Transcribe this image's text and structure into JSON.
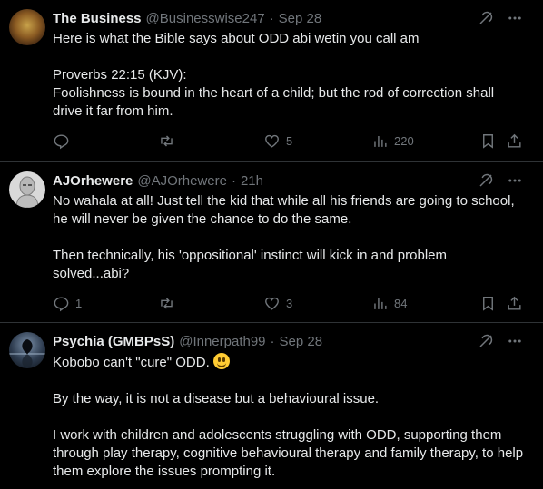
{
  "tweets": [
    {
      "name": "The Business",
      "handle": "@Businesswise247",
      "sep": "·",
      "date": "Sep 28",
      "paragraphs": [
        "Here is what the Bible says about ODD abi wetin you call am",
        "Proverbs 22:15 (KJV):\nFoolishness is bound in the heart of a child; but the rod of correction shall drive it far from him."
      ],
      "replies": "",
      "reposts": "",
      "likes": "5",
      "views": "220"
    },
    {
      "name": "AJOrhewere",
      "handle": "@AJOrhewere",
      "sep": "·",
      "date": "21h",
      "paragraphs": [
        "No wahala at all! Just tell the kid that while all his friends are going to school, he will never be given the chance to do the same.",
        "Then technically, his 'oppositional' instinct will kick in and problem solved...abi?"
      ],
      "replies": "1",
      "reposts": "",
      "likes": "3",
      "views": "84"
    },
    {
      "name": "Psychia (GMBPsS)",
      "handle": "@Innerpath99",
      "sep": "·",
      "date": "Sep 28",
      "paragraphs": [
        "Kobobo can't \"cure\" ODD.",
        "By the way, it is not a disease but  a behavioural issue.",
        "I work with children and adolescents struggling with ODD, supporting them through play therapy, cognitive behavioural therapy and family therapy, to help them explore the issues prompting it."
      ],
      "emoji": "smiling-face-emoji"
    }
  ],
  "colors": {
    "background": "#000000",
    "text": "#e7e9ea",
    "muted": "#71767b",
    "divider": "#2f3336"
  }
}
